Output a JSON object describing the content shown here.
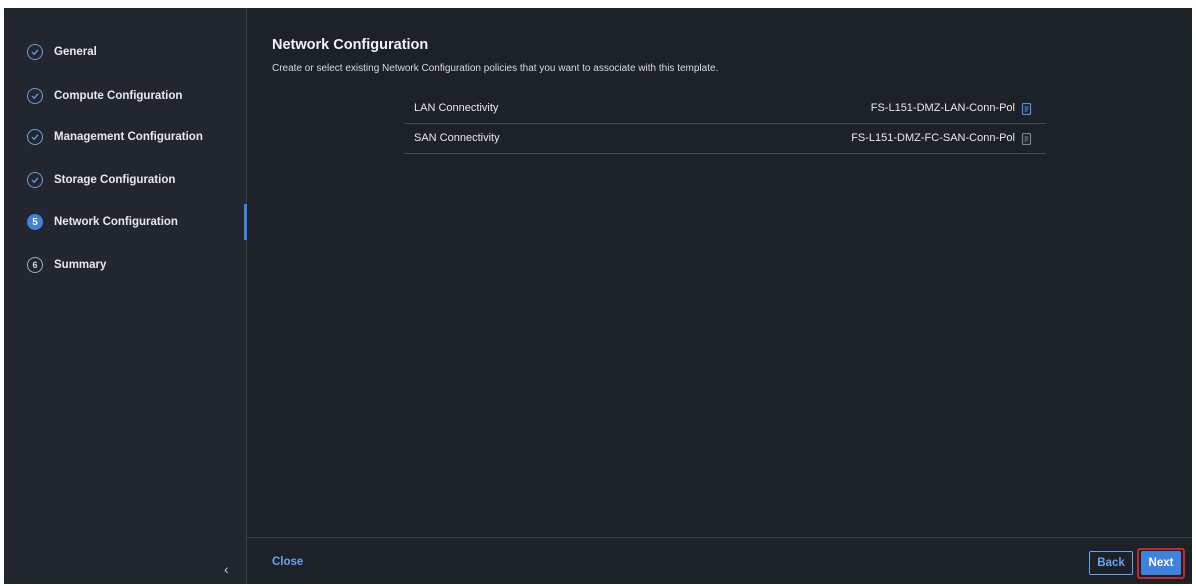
{
  "steps": [
    {
      "label": "General",
      "state": "done",
      "icon": "check-icon"
    },
    {
      "label": "Compute Configuration",
      "state": "done",
      "icon": "check-icon"
    },
    {
      "label": "Management Configuration",
      "state": "done",
      "icon": "check-icon"
    },
    {
      "label": "Storage Configuration",
      "state": "done",
      "icon": "check-icon"
    },
    {
      "label": "Network Configuration",
      "state": "active",
      "number": "5"
    },
    {
      "label": "Summary",
      "state": "pending",
      "number": "6"
    }
  ],
  "sidebar": {
    "collapse_glyph": "‹"
  },
  "main": {
    "title": "Network Configuration",
    "description": "Create or select existing Network Configuration policies that you want to associate with this template.",
    "policies": [
      {
        "label": "LAN Connectivity",
        "value": "FS-L151-DMZ-LAN-Conn-Pol",
        "icon": "document-icon"
      },
      {
        "label": "SAN Connectivity",
        "value": "FS-L151-DMZ-FC-SAN-Conn-Pol",
        "icon": "document-icon"
      }
    ]
  },
  "footer": {
    "close_label": "Close",
    "back_label": "Back",
    "next_label": "Next"
  },
  "colors": {
    "accent": "#3e82dd",
    "highlight_border": "#c7262c",
    "background": "#1d2128"
  }
}
